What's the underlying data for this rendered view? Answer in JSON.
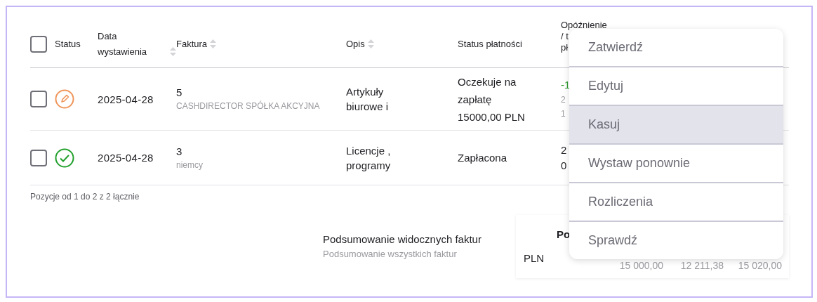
{
  "table": {
    "select_all": {
      "checked": false
    },
    "columns": [
      {
        "label": "Status",
        "sortable": false
      },
      {
        "label": "Data wystawienia",
        "sortable": true
      },
      {
        "label": "Faktura",
        "sortable": true
      },
      {
        "label": "Opis",
        "sortable": true
      },
      {
        "label": "Status płatności",
        "sortable": false
      },
      {
        "lines": [
          "Opóźnienie",
          "/ t",
          "pł"
        ]
      }
    ],
    "rows": [
      {
        "checked": false,
        "status": {
          "kind": "draft"
        },
        "date": "2025-04-28",
        "invoice_number": "5",
        "client": "CASHDIRECTOR SPÓŁKA AKCYJNA",
        "description": "Artykuły biurowe i",
        "payment_status": "Oczekuje na zapłatę",
        "amount": "15000,00 PLN",
        "column_6": [
          {
            "text": "-1",
            "kind": "delay"
          },
          {
            "text": "2",
            "kind": "muted"
          },
          {
            "text": "1",
            "kind": "muted"
          }
        ]
      },
      {
        "checked": false,
        "status": {
          "kind": "paid"
        },
        "date": "2025-04-28",
        "invoice_number": "3",
        "client": "niemcy",
        "description": "Licencje , programy",
        "payment_status": "Zapłacona",
        "column_6": [
          {
            "text": "2",
            "kind": "plain"
          },
          {
            "text": "0",
            "kind": "plain"
          }
        ]
      }
    ]
  },
  "pagination": "Pozycje od 1 do 2 z 2 łącznie",
  "summary": {
    "visible_label": "Podsumowanie widocznych faktur",
    "all_label": "Podsumowanie wszystkich faktur",
    "header": "Po",
    "currency": "PLN",
    "values": [
      "15 000,00",
      "12 211,38",
      "15 020,00"
    ]
  },
  "context_menu": [
    {
      "label": "Zatwierdź",
      "selected": false
    },
    {
      "label": "Edytuj",
      "selected": false
    },
    {
      "label": "Kasuj",
      "selected": true
    },
    {
      "label": "Wystaw ponownie",
      "selected": false
    },
    {
      "label": "Rozliczenia",
      "selected": false
    },
    {
      "label": "Sprawdź",
      "selected": false
    }
  ]
}
